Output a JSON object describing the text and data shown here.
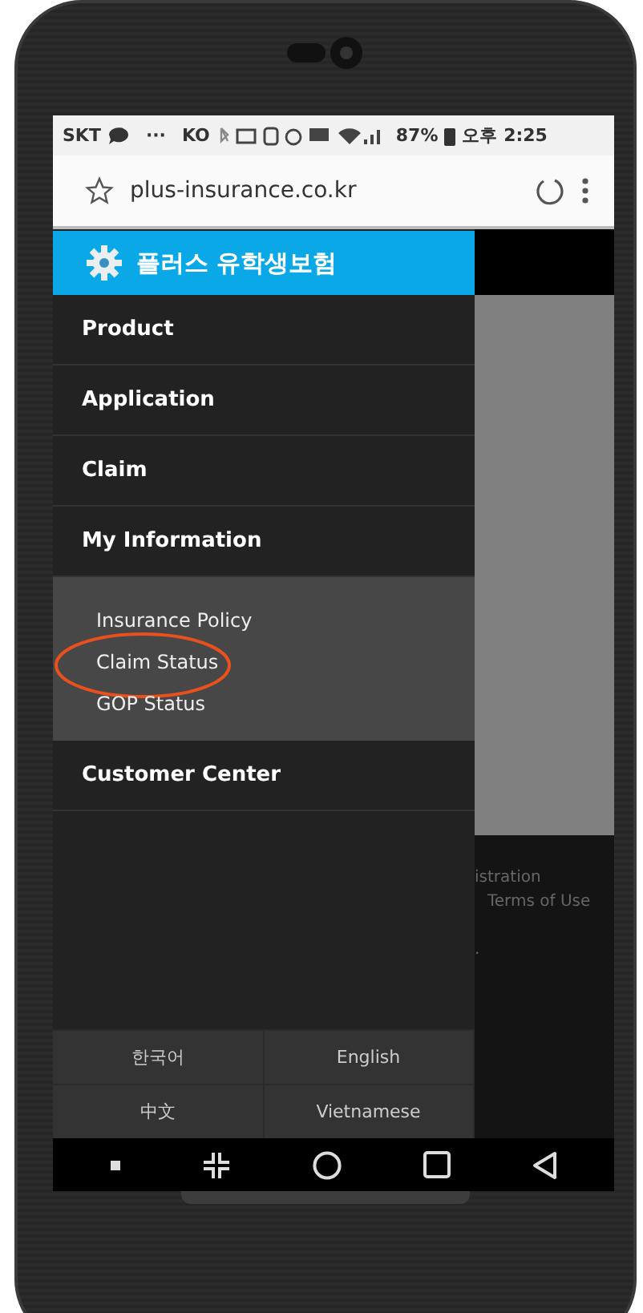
{
  "status_bar": {
    "carrier": "SKT",
    "dots": "···",
    "lang": "KO",
    "battery": "87%",
    "time": "오후 2:25"
  },
  "browser": {
    "url": "plus-insurance.co.kr"
  },
  "drawer": {
    "title": "플러스 유학생보험",
    "menu": [
      {
        "label": "Product"
      },
      {
        "label": "Application"
      },
      {
        "label": "Claim"
      },
      {
        "label": "My Information",
        "children": [
          {
            "label": "Insurance Policy",
            "circled": false
          },
          {
            "label": "Claim Status",
            "circled": true
          },
          {
            "label": "GOP Status",
            "circled": false
          }
        ]
      },
      {
        "label": "Customer Center"
      }
    ],
    "languages": [
      "한국어",
      "English",
      "中文",
      "Vietnamese"
    ]
  },
  "background_page": {
    "footer_lines": [
      "istration",
      "Terms of Use",
      "."
    ]
  }
}
